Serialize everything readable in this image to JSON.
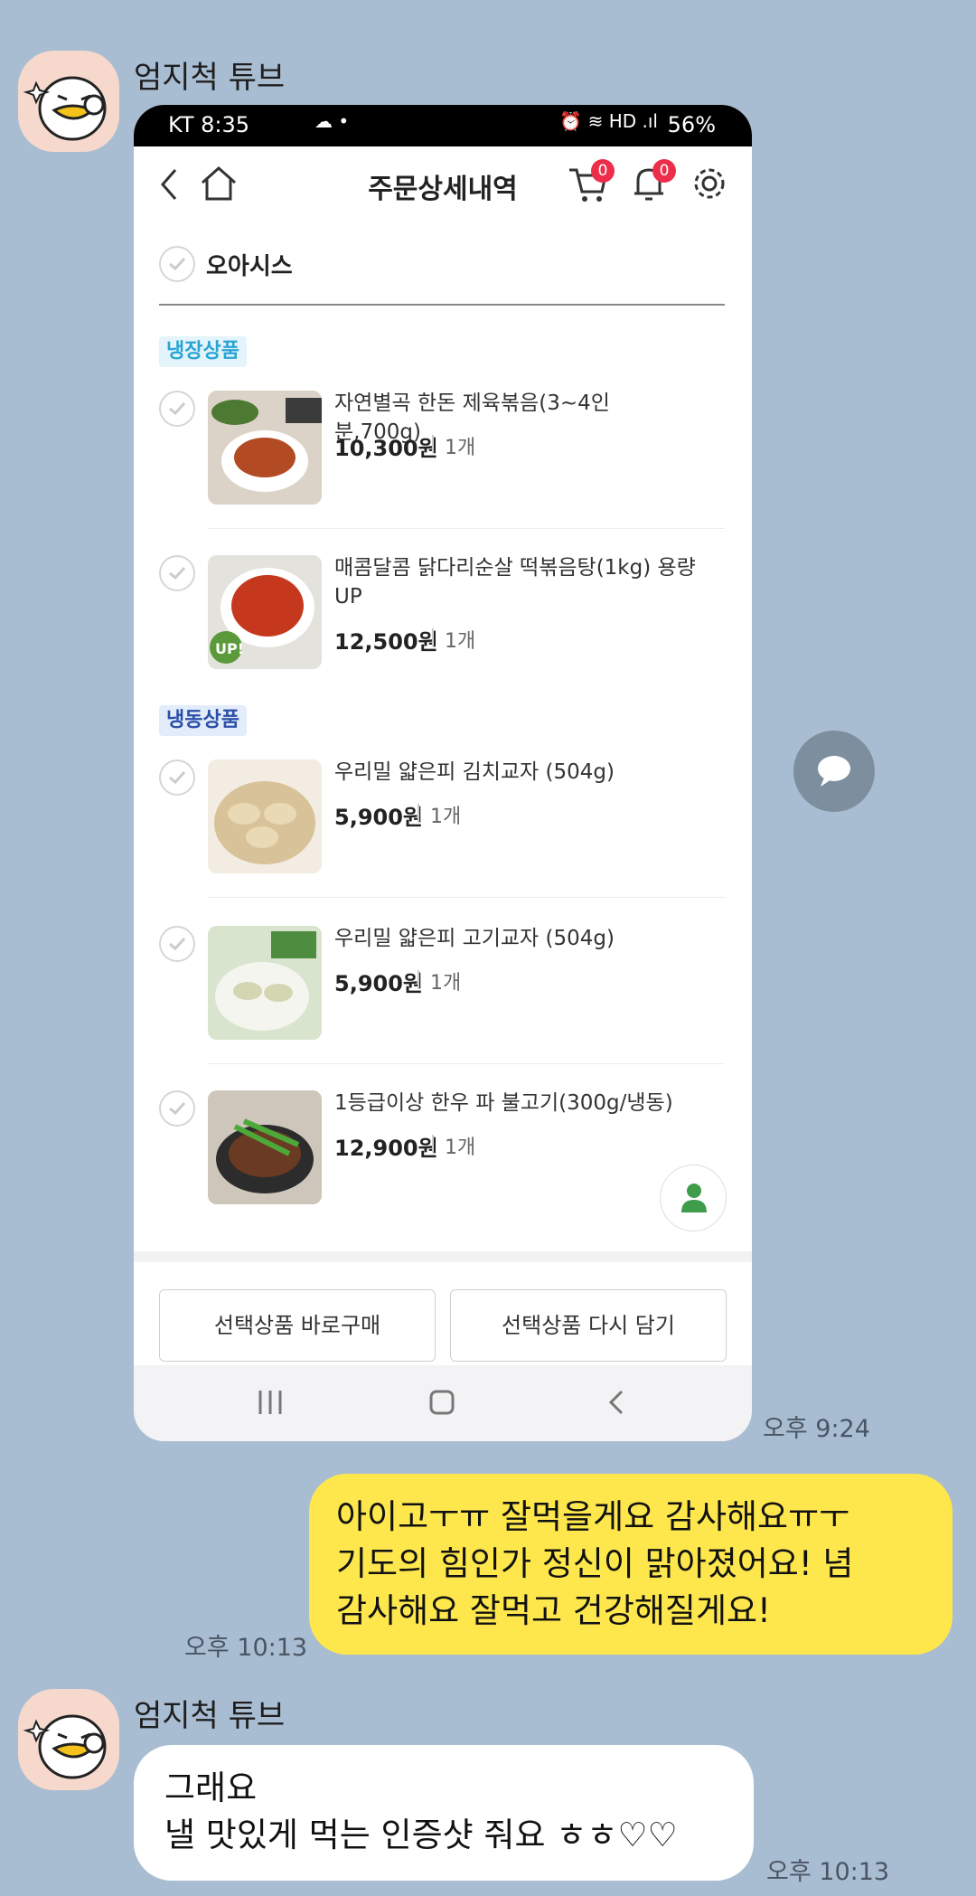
{
  "chat": {
    "sender_name": "엄지척 튜브",
    "msg1_time": "오후 9:24",
    "msg2_time": "오후 10:13",
    "msg2_lines": [
      "아이고ㅜㅠ 잘먹을게요  감사해요ㅠㅜ",
      "기도의 힘인가 정신이 맑아졌어요! 념",
      "감사해요 잘먹고 건강해질게요!"
    ],
    "msg3_time": "오후 10:13",
    "msg3_lines": [
      "그래요",
      "낼 맛있게 먹는 인증샷 줘요 ㅎㅎ♡♡"
    ]
  },
  "screenshot": {
    "status": {
      "left": "KT 8:35",
      "battery": "56%"
    },
    "header": {
      "title": "주문상세내역",
      "cart_count": "0",
      "bell_count": "0"
    },
    "store": "오아시스",
    "sections": [
      {
        "tag": "냉장상품",
        "items": [
          {
            "name": "자연별곡 한돈 제육볶음(3~4인분,700g)",
            "price": "10,300원",
            "qty": "1개"
          },
          {
            "name": "매콤달콤 닭다리순살 떡볶음탕(1kg) 용량 UP",
            "price": "12,500원",
            "qty": "1개",
            "thumb_badge": "UP!"
          }
        ]
      },
      {
        "tag": "냉동상품",
        "items": [
          {
            "name": "우리밀 얇은피 김치교자 (504g)",
            "price": "5,900원",
            "qty": "1개"
          },
          {
            "name": "우리밀 얇은피 고기교자 (504g)",
            "price": "5,900원",
            "qty": "1개"
          },
          {
            "name": "1등급이상 한우 파 불고기(300g/냉동)",
            "price": "12,900원",
            "qty": "1개"
          }
        ]
      }
    ],
    "buttons": {
      "buy_now": "선택상품 바로구매",
      "re_add": "선택상품 다시 담기"
    }
  },
  "colors": {
    "chat_bg": "#a9bdd2",
    "my_bubble": "#fde74c",
    "badge_red": "#ec2e4b",
    "tag_chilled_bg": "#e3f4fb",
    "tag_chilled_fg": "#2aa4d5",
    "tag_frozen_bg": "#e3ecfa",
    "tag_frozen_fg": "#2b4fa8"
  }
}
